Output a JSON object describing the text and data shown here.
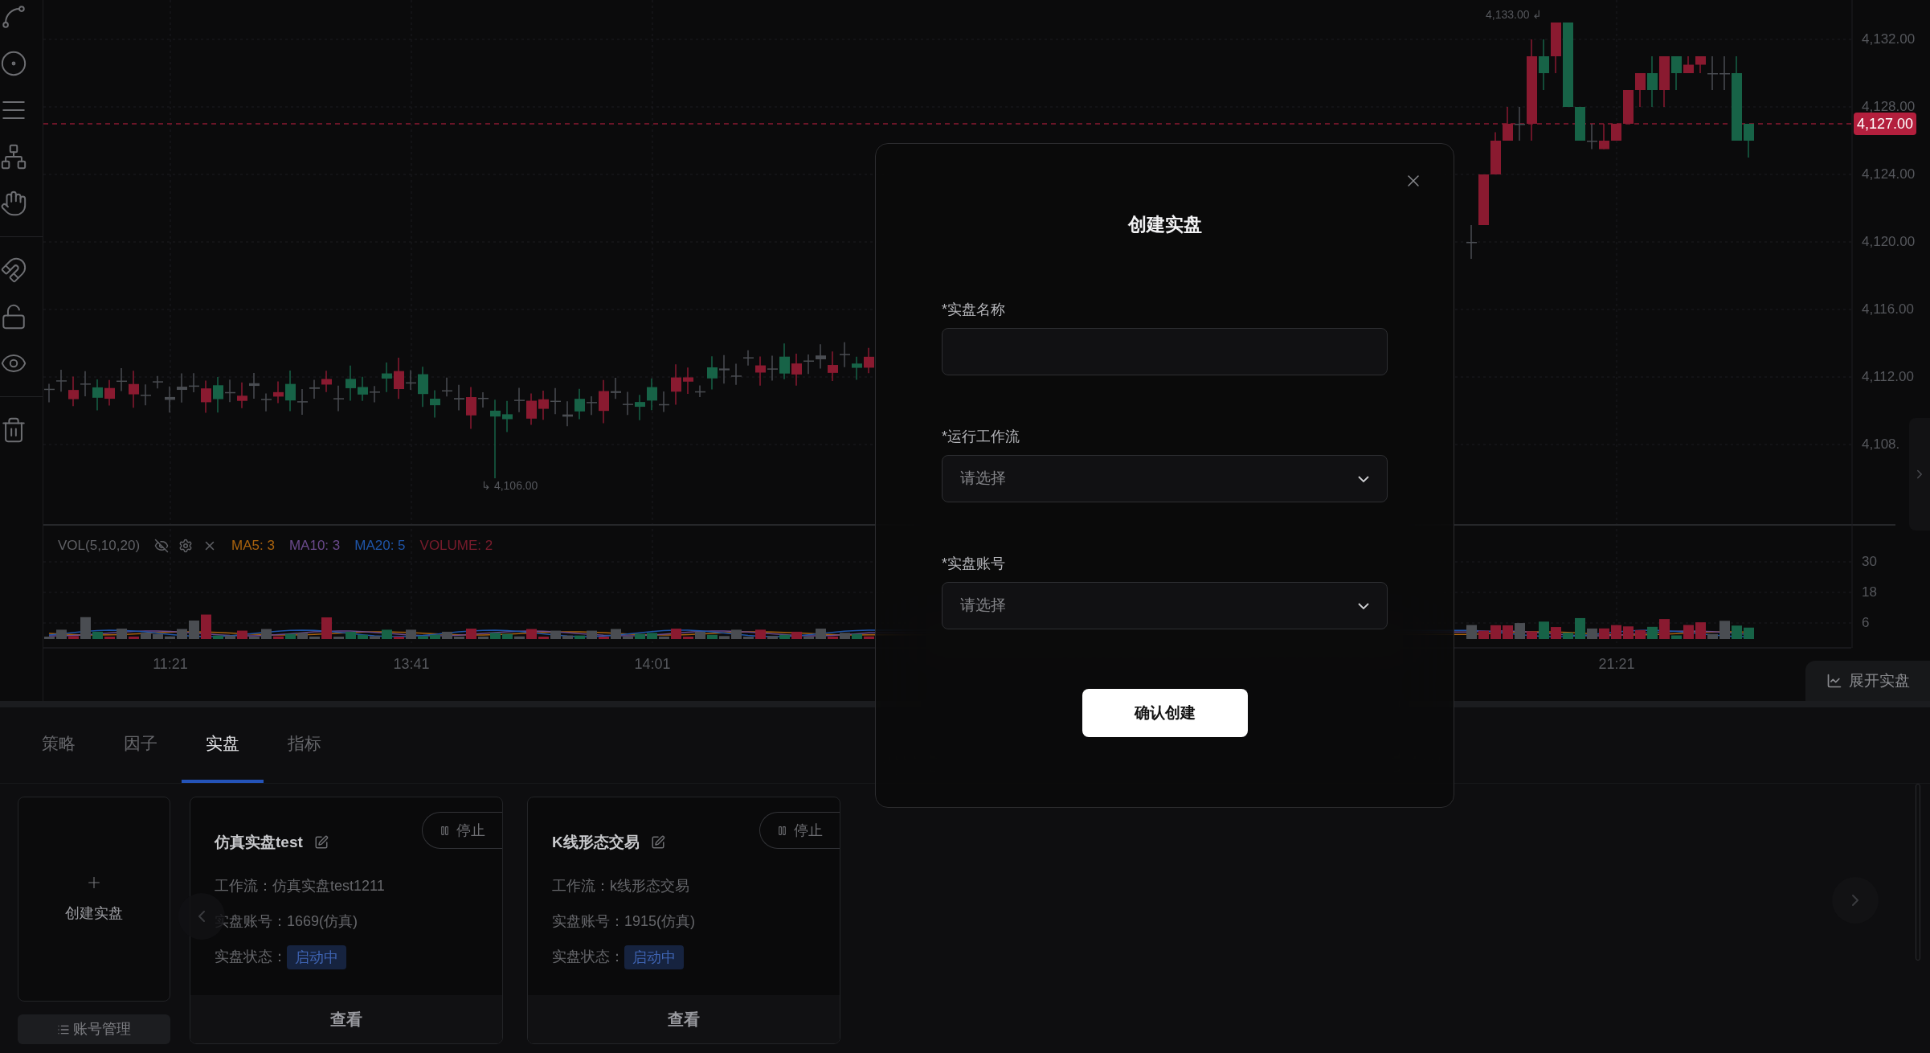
{
  "chart": {
    "price_ticks": [
      "4,132.00",
      "4,128.00",
      "4,124.00",
      "4,120.00",
      "4,116.00",
      "4,112.00",
      "4,108."
    ],
    "last_price": "4,127.00",
    "high_label": "4,133.00",
    "high_marker": "↲",
    "low_marker": "↳",
    "low_label": "4,106.00",
    "volume_ticks": [
      "30",
      "18",
      "6"
    ],
    "time_ticks": [
      "11:21",
      "13:41",
      "14:01",
      "21:21"
    ]
  },
  "volume_legend": {
    "title": "VOL(5,10,20)",
    "items": [
      {
        "label": "MA5: 3",
        "color": "#a8620e"
      },
      {
        "label": "MA10: 3",
        "color": "#6a4a8c"
      },
      {
        "label": "MA20: 5",
        "color": "#1f55a8"
      },
      {
        "label": "VOLUME: 2",
        "color": "#7a1c2c"
      }
    ]
  },
  "expand_button": "展开实盘",
  "tabs": [
    {
      "label": "策略",
      "selected": false
    },
    {
      "label": "因子",
      "selected": false
    },
    {
      "label": "实盘",
      "selected": true
    },
    {
      "label": "指标",
      "selected": false
    }
  ],
  "create_card": {
    "label": "创建实盘"
  },
  "account_button": "账号管理",
  "cards": [
    {
      "title": "仿真实盘test",
      "stop_button": "停止",
      "fields": [
        {
          "kind": "text",
          "label": "工作流：",
          "value": "仿真实盘test1211"
        },
        {
          "kind": "text",
          "label": "实盘账号：",
          "value": "1669(仿真)"
        },
        {
          "kind": "badge",
          "label": "实盘状态：",
          "value": "启动中"
        }
      ],
      "view_button": "查看"
    },
    {
      "title": "K线形态交易",
      "stop_button": "停止",
      "fields": [
        {
          "kind": "text",
          "label": "工作流：",
          "value": "k线形态交易"
        },
        {
          "kind": "text",
          "label": "实盘账号：",
          "value": "1915(仿真)"
        },
        {
          "kind": "badge",
          "label": "实盘状态：",
          "value": "启动中"
        }
      ],
      "view_button": "查看"
    }
  ],
  "dialog": {
    "title": "创建实盘",
    "fields": [
      {
        "kind": "input",
        "label": "*实盘名称"
      },
      {
        "kind": "select",
        "label": "*运行工作流",
        "placeholder": "请选择"
      },
      {
        "kind": "select",
        "label": "*实盘账号",
        "placeholder": "请选择"
      }
    ],
    "confirm_button": "确认创建"
  }
}
